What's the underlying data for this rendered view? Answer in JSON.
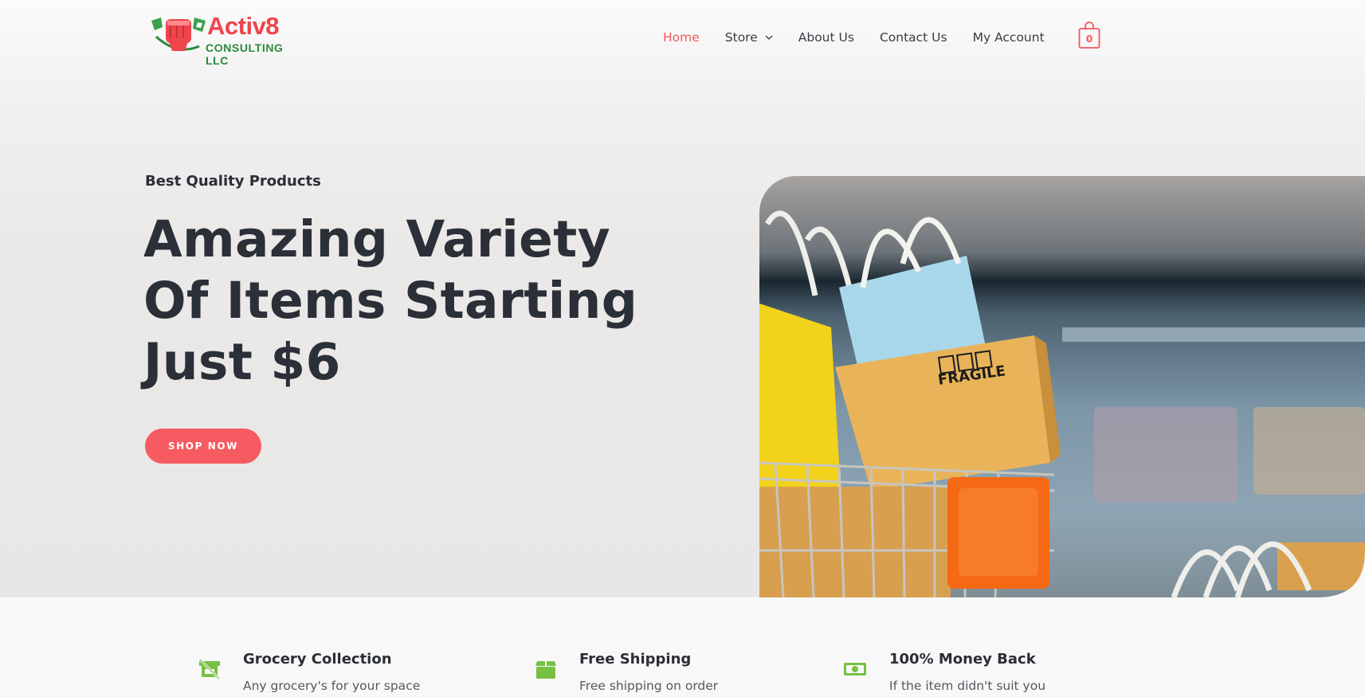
{
  "brand": {
    "name": "Activ8",
    "subtitle": "CONSULTING LLC",
    "primary_color": "#f2585e",
    "logo_green": "#2c8a3c"
  },
  "nav": {
    "items": [
      {
        "label": "Home",
        "active": true
      },
      {
        "label": "Store",
        "has_dropdown": true
      },
      {
        "label": "About Us"
      },
      {
        "label": "Contact Us"
      },
      {
        "label": "My Account"
      }
    ],
    "cart_count": "0"
  },
  "hero": {
    "kicker": "Best Quality Products",
    "headline_lines": [
      "Amazing Variety",
      "Of Items Starting",
      "Just $6"
    ],
    "cta_label": "SHOP NOW",
    "image_box_text": "FRAGILE"
  },
  "features": [
    {
      "icon": "grocery-icon",
      "title": "Grocery Collection",
      "desc": "Any grocery's for your space"
    },
    {
      "icon": "box-icon",
      "title": "Free Shipping",
      "desc": "Free shipping on order"
    },
    {
      "icon": "money-icon",
      "title": "100% Money Back",
      "desc": "If the item didn't suit you"
    }
  ],
  "colors": {
    "accent": "#f55b61",
    "feature_icon": "#77c043",
    "heading": "#2b2f37"
  }
}
